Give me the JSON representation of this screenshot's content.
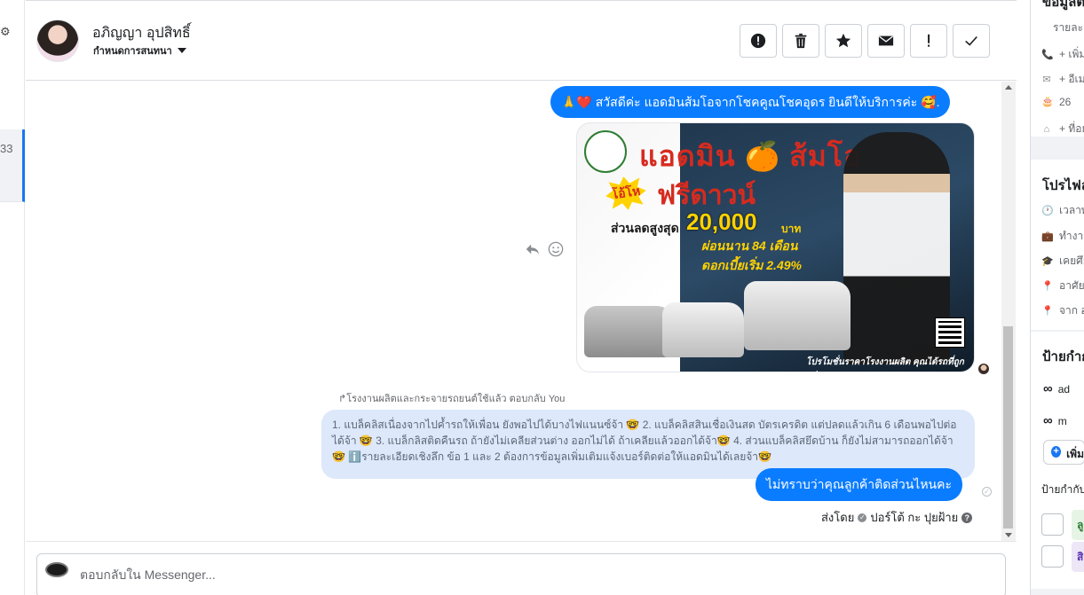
{
  "conversation": {
    "contact_name": "อภิญญา อุปสิทธิ์",
    "assign_label": "กำหนดการสนทนา",
    "left_list_badge": "33",
    "left_icon_glyph": "⚙"
  },
  "toolbar": {
    "buttons": [
      {
        "name": "spam-icon",
        "glyph": "!"
      },
      {
        "name": "trash-icon"
      },
      {
        "name": "star-icon"
      },
      {
        "name": "envelope-icon"
      },
      {
        "name": "exclamation-icon",
        "glyph": "!"
      },
      {
        "name": "checkmark-icon"
      }
    ]
  },
  "messages": {
    "greeting": "🙏❤️ สวัสดีค่ะ แอดมินส้มโอจากโชคคูณโชคอุดร ยินดีให้บริการค่ะ 🥰.",
    "ad_image": {
      "title": "แอดมิน 🍊 ส้มโอ",
      "badge": "โอ้โห",
      "headline": "ฟรีดาวน์",
      "discount_label": "ส่วนลดสูงสุด",
      "discount_amount": "20,000",
      "discount_unit": "บาท",
      "installment": "ผ่อนนาน 84 เดือน",
      "interest": "ดอกเบี้ยเริ่ม 2.49%",
      "footer": "โปรโมชั่นราคาโรงงานผลิต คุณได้รถที่ถูกกว่า"
    },
    "reply_meta": "↱โรงงานผลิตและกระจายรถยนต์ใช้แล้ว ตอบกลับ You",
    "quoted_text": "1. แบล็คลิสเนื่องจากไปค้ำรถให้เพื่อน ยังพอไปได้บางไฟแนนซ์จ้า 🤓 2. แบล็คลิสสินเชื่อเงินสด บัตรเครดิต แต่ปลดแล้วเกิน 6 เดือนพอไปต่อได้จ้า 🤓 3. แบล็กลิสติดคืนรถ ถ้ายังไม่เคลียส่วนต่าง ออกไม่ได้ ถ้าเคลียแล้วออกได้จ้า🤓 4. ส่วนแบล็คลิสยึดบ้าน ก็ยังไม่สามารถออกได้จ้า🤓 ℹ️รายละเอียดเชิงลึก ข้อ 1 และ 2 ต้องการข้อมูลเพิ่มเติมแจ้งเบอร์ติดต่อให้แอดมินได้เลยจ้า🤓",
    "question": "ไม่ทราบว่าคุณลูกค้าติดส่วนไหนคะ",
    "sent_by": "ส่งโดย",
    "sender": "ปอร์โต้ กะ ปุยฝ้าย"
  },
  "composer": {
    "placeholder": "ตอบกลับใน Messenger..."
  },
  "right_panel": {
    "section1_title": "ข้อมูลติดต่อ",
    "contact_rows": [
      {
        "icon": "📞",
        "text": "+ เพิ่มหมายเลขโทรศัพท์"
      },
      {
        "icon": "✉",
        "text": "+ อีเมล"
      },
      {
        "icon": "🎂",
        "text": "26"
      },
      {
        "icon": "⌂",
        "text": "+ ที่อยู่"
      }
    ],
    "contact_label": "รายละเอียด",
    "section2_title": "โปรไฟล์",
    "profile_rows": [
      {
        "icon": "🕐",
        "text": "เวลาท้องถิ่น"
      },
      {
        "icon": "💼",
        "text": "ทำงานที่"
      },
      {
        "icon": "🎓",
        "text": "เคยศึกษาที่"
      },
      {
        "icon": "📍",
        "text": "อาศัยอยู่ที่"
      },
      {
        "icon": "📍",
        "text": "จาก อุดร"
      }
    ],
    "section3_title": "ป้ายกำกับ",
    "ads_rows": [
      {
        "text": "ad"
      },
      {
        "text": "m"
      }
    ],
    "add_label": "เพิ่ม",
    "subsection_title": "ป้ายกำกับ",
    "labels": [
      {
        "text": "ลู",
        "bg": "#e6f4e6",
        "color": "#2e7d32"
      },
      {
        "text": "สิ",
        "bg": "#ece6f6",
        "color": "#5e35b1"
      }
    ]
  },
  "colors": {
    "accent": "#0a7cff",
    "quote_bg": "#dde8fb",
    "selected_border": "#1877f2"
  }
}
